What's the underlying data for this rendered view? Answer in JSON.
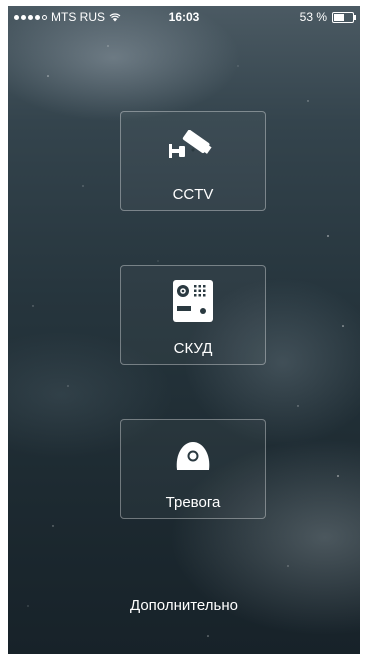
{
  "status_bar": {
    "carrier": "MTS RUS",
    "time": "16:03",
    "battery": "53 %",
    "battery_level": 0.53,
    "signal_bars_filled": 4,
    "signal_bars_total": 5
  },
  "menu": {
    "cctv": {
      "label": "CCTV",
      "icon": "cctv-camera-icon"
    },
    "skud": {
      "label": "СКУД",
      "icon": "intercom-panel-icon"
    },
    "alarm": {
      "label": "Тревога",
      "icon": "alarm-button-icon"
    }
  },
  "footer": {
    "more_label": "Дополнительно"
  },
  "colors": {
    "text": "#ffffff",
    "tile_border": "#8a949a",
    "background_top": "#4b5a63",
    "background_bottom": "#172229"
  }
}
